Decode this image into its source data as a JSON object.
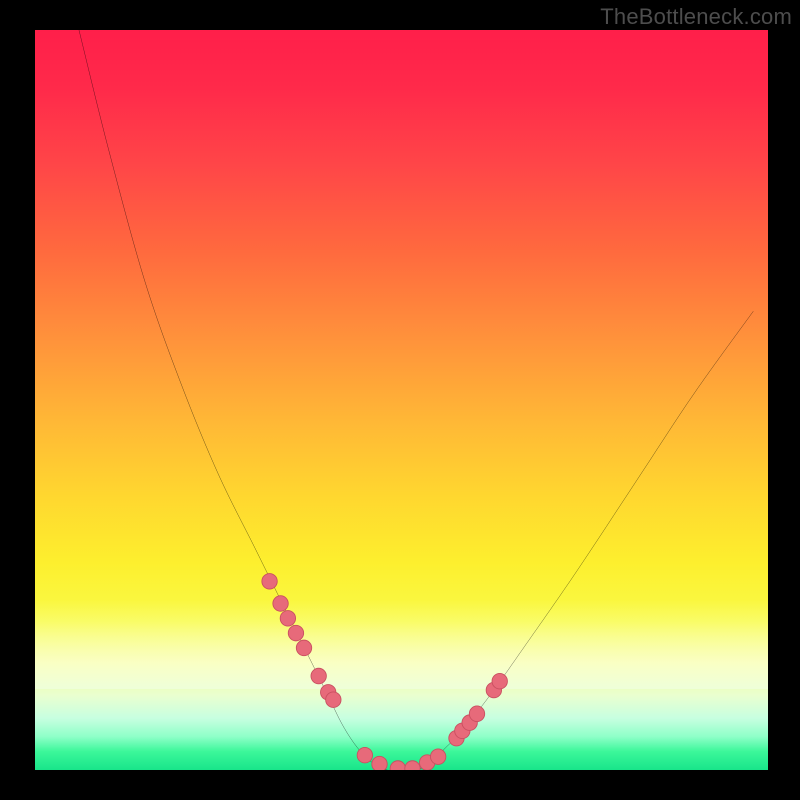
{
  "watermark": "TheBottleneck.com",
  "colors": {
    "frame": "#000000",
    "curve_stroke": "#000000",
    "marker_fill": "#e76a7a",
    "marker_stroke": "#c94f60",
    "gradient_top": "#ff1f4a",
    "gradient_bottom": "#18e58a"
  },
  "chart_data": {
    "type": "line",
    "title": "",
    "xlabel": "",
    "ylabel": "",
    "x_range": [
      0,
      100
    ],
    "y_range": [
      0,
      100
    ],
    "grid": false,
    "legend": false,
    "series": [
      {
        "name": "bottleneck-curve",
        "x": [
          6,
          10,
          15,
          20,
          25,
          30,
          34,
          37,
          40,
          42,
          44,
          46,
          48,
          50,
          52,
          54,
          56,
          58,
          62,
          67,
          74,
          82,
          90,
          98
        ],
        "y": [
          100,
          84,
          66,
          52,
          40,
          30,
          22,
          16,
          10,
          6,
          3,
          1,
          0,
          0,
          0,
          1,
          3,
          5,
          10,
          17,
          27,
          39,
          51,
          62
        ]
      }
    ],
    "markers": {
      "name": "highlight-points",
      "x": [
        32.0,
        33.5,
        34.5,
        35.6,
        36.7,
        38.7,
        40.0,
        40.7,
        45.0,
        47.0,
        49.5,
        51.5,
        53.5,
        55.0,
        57.5,
        58.3,
        59.3,
        60.3,
        62.6,
        63.4
      ],
      "y": [
        25.5,
        22.5,
        20.5,
        18.5,
        16.5,
        12.7,
        10.5,
        9.5,
        2.0,
        0.8,
        0.2,
        0.2,
        1.0,
        1.8,
        4.3,
        5.3,
        6.4,
        7.6,
        10.8,
        12.0
      ]
    }
  }
}
